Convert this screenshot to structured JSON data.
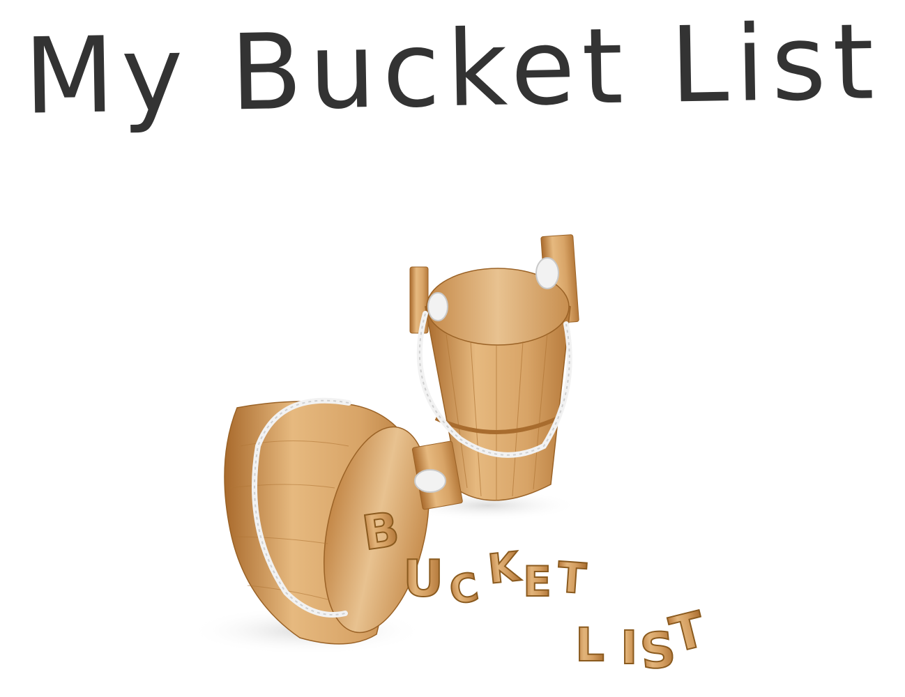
{
  "page": {
    "title": "My Bucket List"
  },
  "illustration": {
    "description_icon": "wooden-buckets-image",
    "letters": {
      "b": "B",
      "u": "U",
      "c": "C",
      "k": "K",
      "e": "E",
      "t": "T",
      "l": "L",
      "i": "I",
      "s": "S",
      "t2": "T"
    },
    "colors": {
      "wood_light": "#e7bd85",
      "wood_mid": "#d19a5a",
      "wood_dark": "#a86c2e",
      "rope": "#f2f2f2",
      "title": "#333333"
    }
  }
}
